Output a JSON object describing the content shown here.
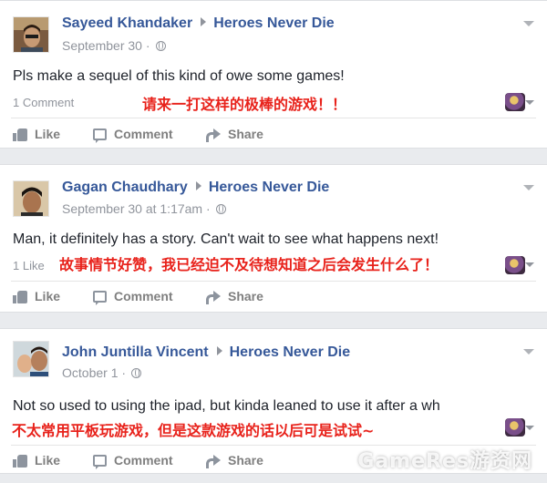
{
  "posts": [
    {
      "author": "Sayeed Khandaker",
      "page": "Heroes Never Die",
      "time": "September 30 ·",
      "text": "Pls make a sequel of this kind of owe some games!",
      "count": "1 Comment",
      "translation": "请来一打这样的极棒的游戏！！",
      "avatar_icon": "profile-photo"
    },
    {
      "author": "Gagan Chaudhary",
      "page": "Heroes Never Die",
      "time": "September 30 at 1:17am ·",
      "text": "Man, it definitely has a story. Can't wait to see what happens next!",
      "count": "1 Like",
      "translation": "故事情节好赞，我已经迫不及待想知道之后会发生什么了！",
      "avatar_icon": "profile-photo"
    },
    {
      "author": "John Juntilla Vincent",
      "page": "Heroes Never Die",
      "time": "October 1 ·",
      "text": "Not so used to using the ipad, but kinda leaned to use it after a wh",
      "count": "",
      "translation": "不太常用平板玩游戏，但是这款游戏的话以后可是试试~",
      "avatar_icon": "profile-photo"
    }
  ],
  "actions": {
    "like": "Like",
    "comment": "Comment",
    "share": "Share"
  },
  "watermark": "GameRes游资网",
  "colors": {
    "name": "#365899",
    "translation": "#e8221b",
    "meta": "#90949c",
    "background": "#e9ebee"
  }
}
